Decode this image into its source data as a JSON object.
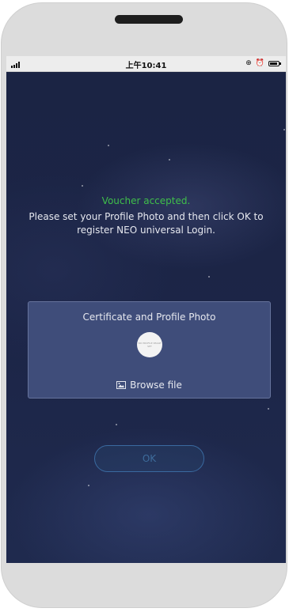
{
  "status_bar": {
    "time": "上午10:41",
    "icons": [
      "signal-icon",
      "sync-icon",
      "alarm-icon",
      "battery-icon"
    ]
  },
  "messages": {
    "accepted": "Voucher accepted.",
    "instruction": "Please set your Profile Photo and then click OK to register NEO universal Login."
  },
  "profile_card": {
    "title": "Certificate and Profile Photo",
    "avatar_text": "NO PROFILE IMAGE SET",
    "browse_label": "Browse file"
  },
  "actions": {
    "ok_label": "OK"
  },
  "colors": {
    "accepted_text": "#3fbf4a",
    "background": "#1c2547",
    "card": "#3f4d7a",
    "ok_outline": "#3a6aa0"
  }
}
